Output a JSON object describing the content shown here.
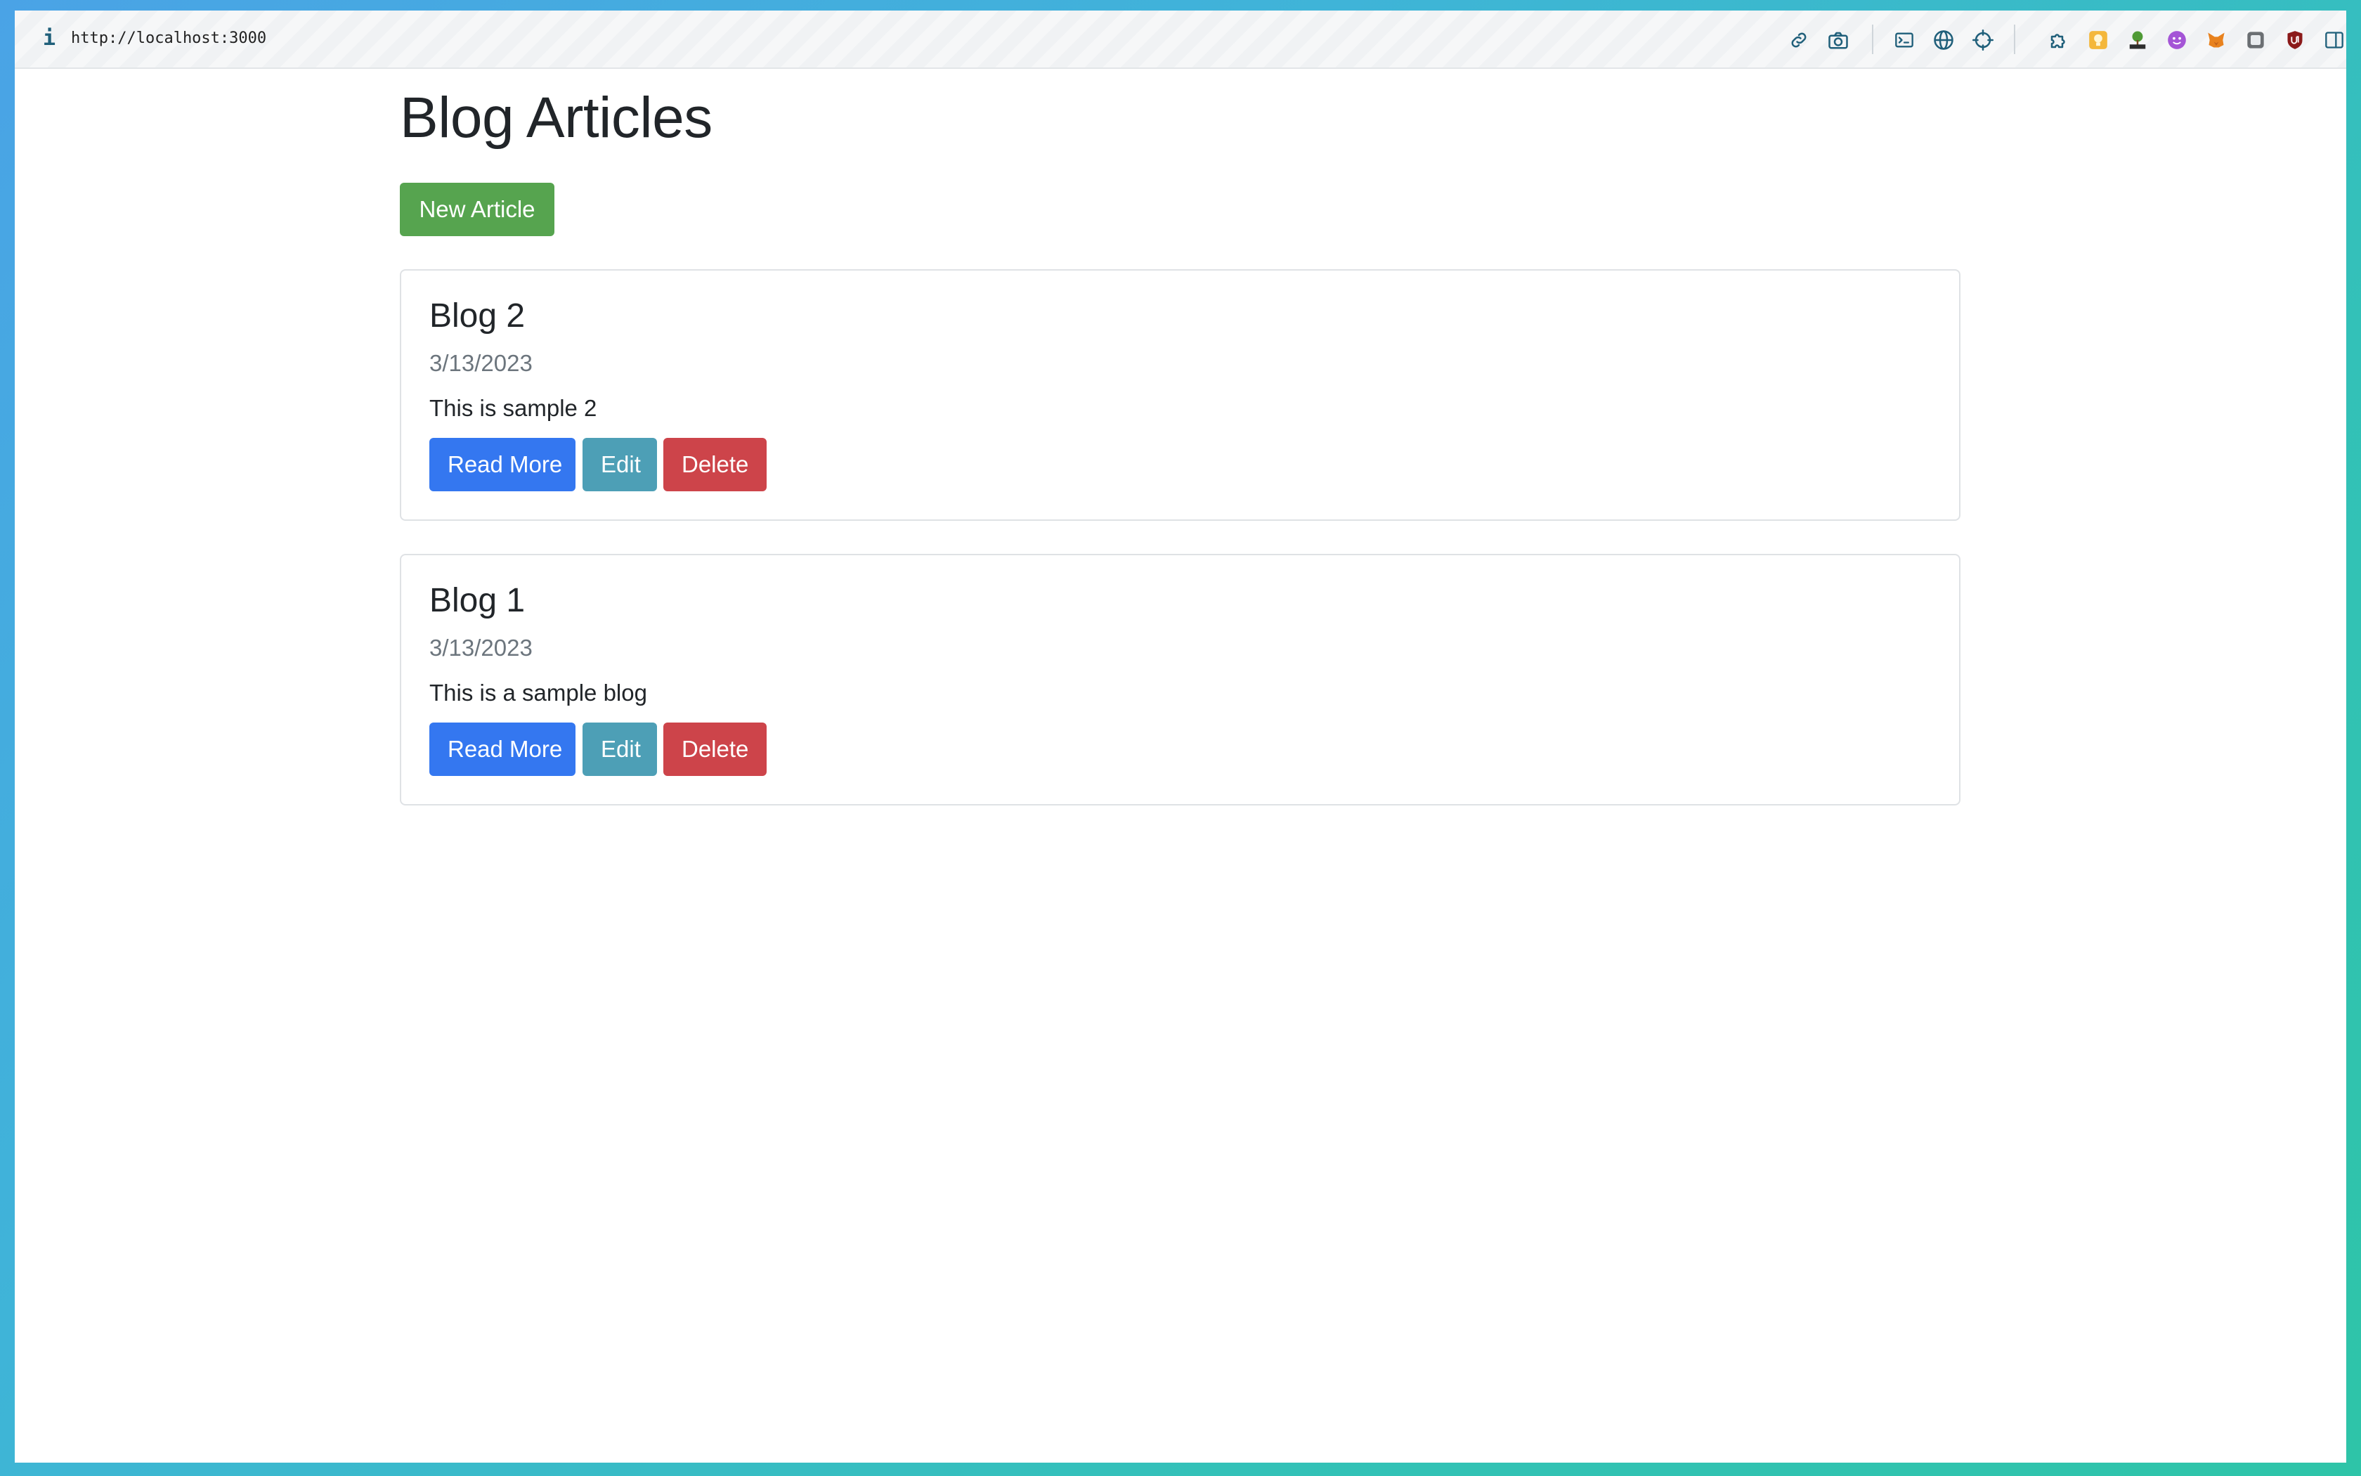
{
  "browser": {
    "info_glyph": "i",
    "url": "http://localhost:3000",
    "toolbar_icons": [
      "link-icon",
      "camera-icon",
      "terminal-icon",
      "globe-icon",
      "crosshair-icon",
      "extensions-icon",
      "lightbulb-extension-icon",
      "html-tree-extension-icon",
      "purple-face-extension-icon",
      "metamask-fox-icon",
      "square-extension-icon",
      "ublock-shield-icon",
      "sidebar-toggle-icon"
    ]
  },
  "page": {
    "title": "Blog Articles",
    "new_article_label": "New Article"
  },
  "articles": [
    {
      "title": "Blog 2",
      "date": "3/13/2023",
      "body": "This is sample 2",
      "read_more_label": "Read More",
      "edit_label": "Edit",
      "delete_label": "Delete"
    },
    {
      "title": "Blog 1",
      "date": "3/13/2023",
      "body": "This is a sample blog",
      "read_more_label": "Read More",
      "edit_label": "Edit",
      "delete_label": "Delete"
    }
  ],
  "colors": {
    "new_button": "#56a44f",
    "read_more_button": "#3477f0",
    "edit_button": "#4d9fb6",
    "delete_button": "#cd444a",
    "toolbar_icon": "#1f5f7a"
  }
}
